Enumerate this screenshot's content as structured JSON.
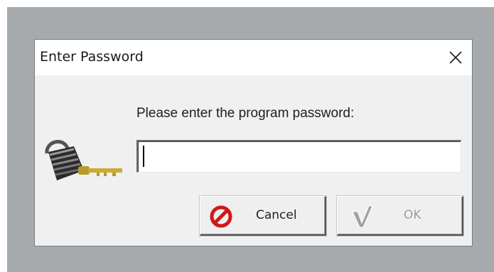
{
  "dialog": {
    "title": "Enter Password",
    "prompt": "Please enter the program password:",
    "password_value": "",
    "buttons": {
      "cancel_label": "Cancel",
      "ok_label": "OK"
    },
    "icons": {
      "main": "padlock-with-key-icon",
      "close": "close-icon",
      "cancel": "cancel-no-sign-icon",
      "ok": "checkmark-icon"
    }
  },
  "colors": {
    "backdrop": "#a6aaad",
    "dialog_bg": "#f0f0f0",
    "titlebar_bg": "#ffffff",
    "cancel_icon": "#d01818",
    "ok_disabled": "#9a9a9a"
  }
}
